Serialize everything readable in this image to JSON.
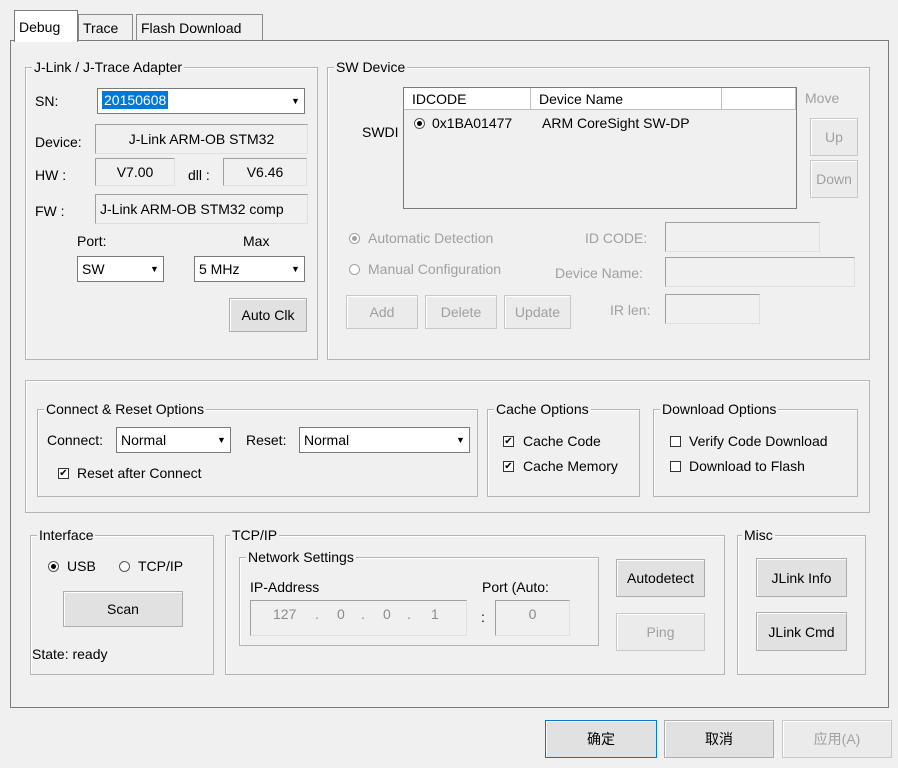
{
  "tabs": [
    "Debug",
    "Trace",
    "Flash Download"
  ],
  "adapter": {
    "legend": "J-Link / J-Trace Adapter",
    "sn_label": "SN:",
    "sn_value": "20150608",
    "device_label": "Device:",
    "device_value": "J-Link ARM-OB STM32",
    "hw_label": "HW :",
    "hw_value": "V7.00",
    "dll_label": "dll :",
    "dll_value": "V6.46",
    "fw_label": "FW :",
    "fw_value": "J-Link ARM-OB STM32 comp",
    "port_label": "Port:",
    "port_value": "SW",
    "max_label": "Max",
    "max_value": "5 MHz",
    "autoclk_label": "Auto Clk"
  },
  "sw_device": {
    "legend": "SW Device",
    "swdi_label": "SWDI",
    "columns": [
      "IDCODE",
      "Device Name",
      ""
    ],
    "rows": [
      {
        "idcode": "0x1BA01477",
        "name": "ARM CoreSight SW-DP"
      }
    ],
    "move_label": "Move",
    "up_label": "Up",
    "down_label": "Down",
    "auto_detect_label": "Automatic Detection",
    "manual_config_label": "Manual Configuration",
    "idcode_label": "ID CODE:",
    "device_name_label": "Device Name:",
    "irlen_label": "IR len:",
    "add_label": "Add",
    "delete_label": "Delete",
    "update_label": "Update"
  },
  "connect_reset": {
    "legend": "Connect & Reset Options",
    "connect_label": "Connect:",
    "connect_value": "Normal",
    "reset_label": "Reset:",
    "reset_value": "Normal",
    "reset_after_label": "Reset after Connect"
  },
  "cache": {
    "legend": "Cache Options",
    "code_label": "Cache Code",
    "memory_label": "Cache Memory"
  },
  "download": {
    "legend": "Download Options",
    "verify_label": "Verify Code Download",
    "flash_label": "Download to Flash"
  },
  "interface": {
    "legend": "Interface",
    "usb_label": "USB",
    "tcpip_label": "TCP/IP",
    "scan_label": "Scan",
    "state_label": "State: ready"
  },
  "tcpip": {
    "legend": "TCP/IP",
    "network_legend": "Network Settings",
    "ip_label": "IP-Address",
    "port_label": "Port (Auto:",
    "ip_parts": [
      "127",
      "0",
      "0",
      "1"
    ],
    "dot": ".",
    "colon": ":",
    "port_value": "0",
    "autodetect_label": "Autodetect",
    "ping_label": "Ping"
  },
  "misc": {
    "legend": "Misc",
    "jlink_info_label": "JLink Info",
    "jlink_cmd_label": "JLink Cmd"
  },
  "footer": {
    "ok_label": "确定",
    "cancel_label": "取消",
    "apply_label": "应用(A)"
  },
  "check_mark": "✔",
  "dropdown_arrow": "▼"
}
